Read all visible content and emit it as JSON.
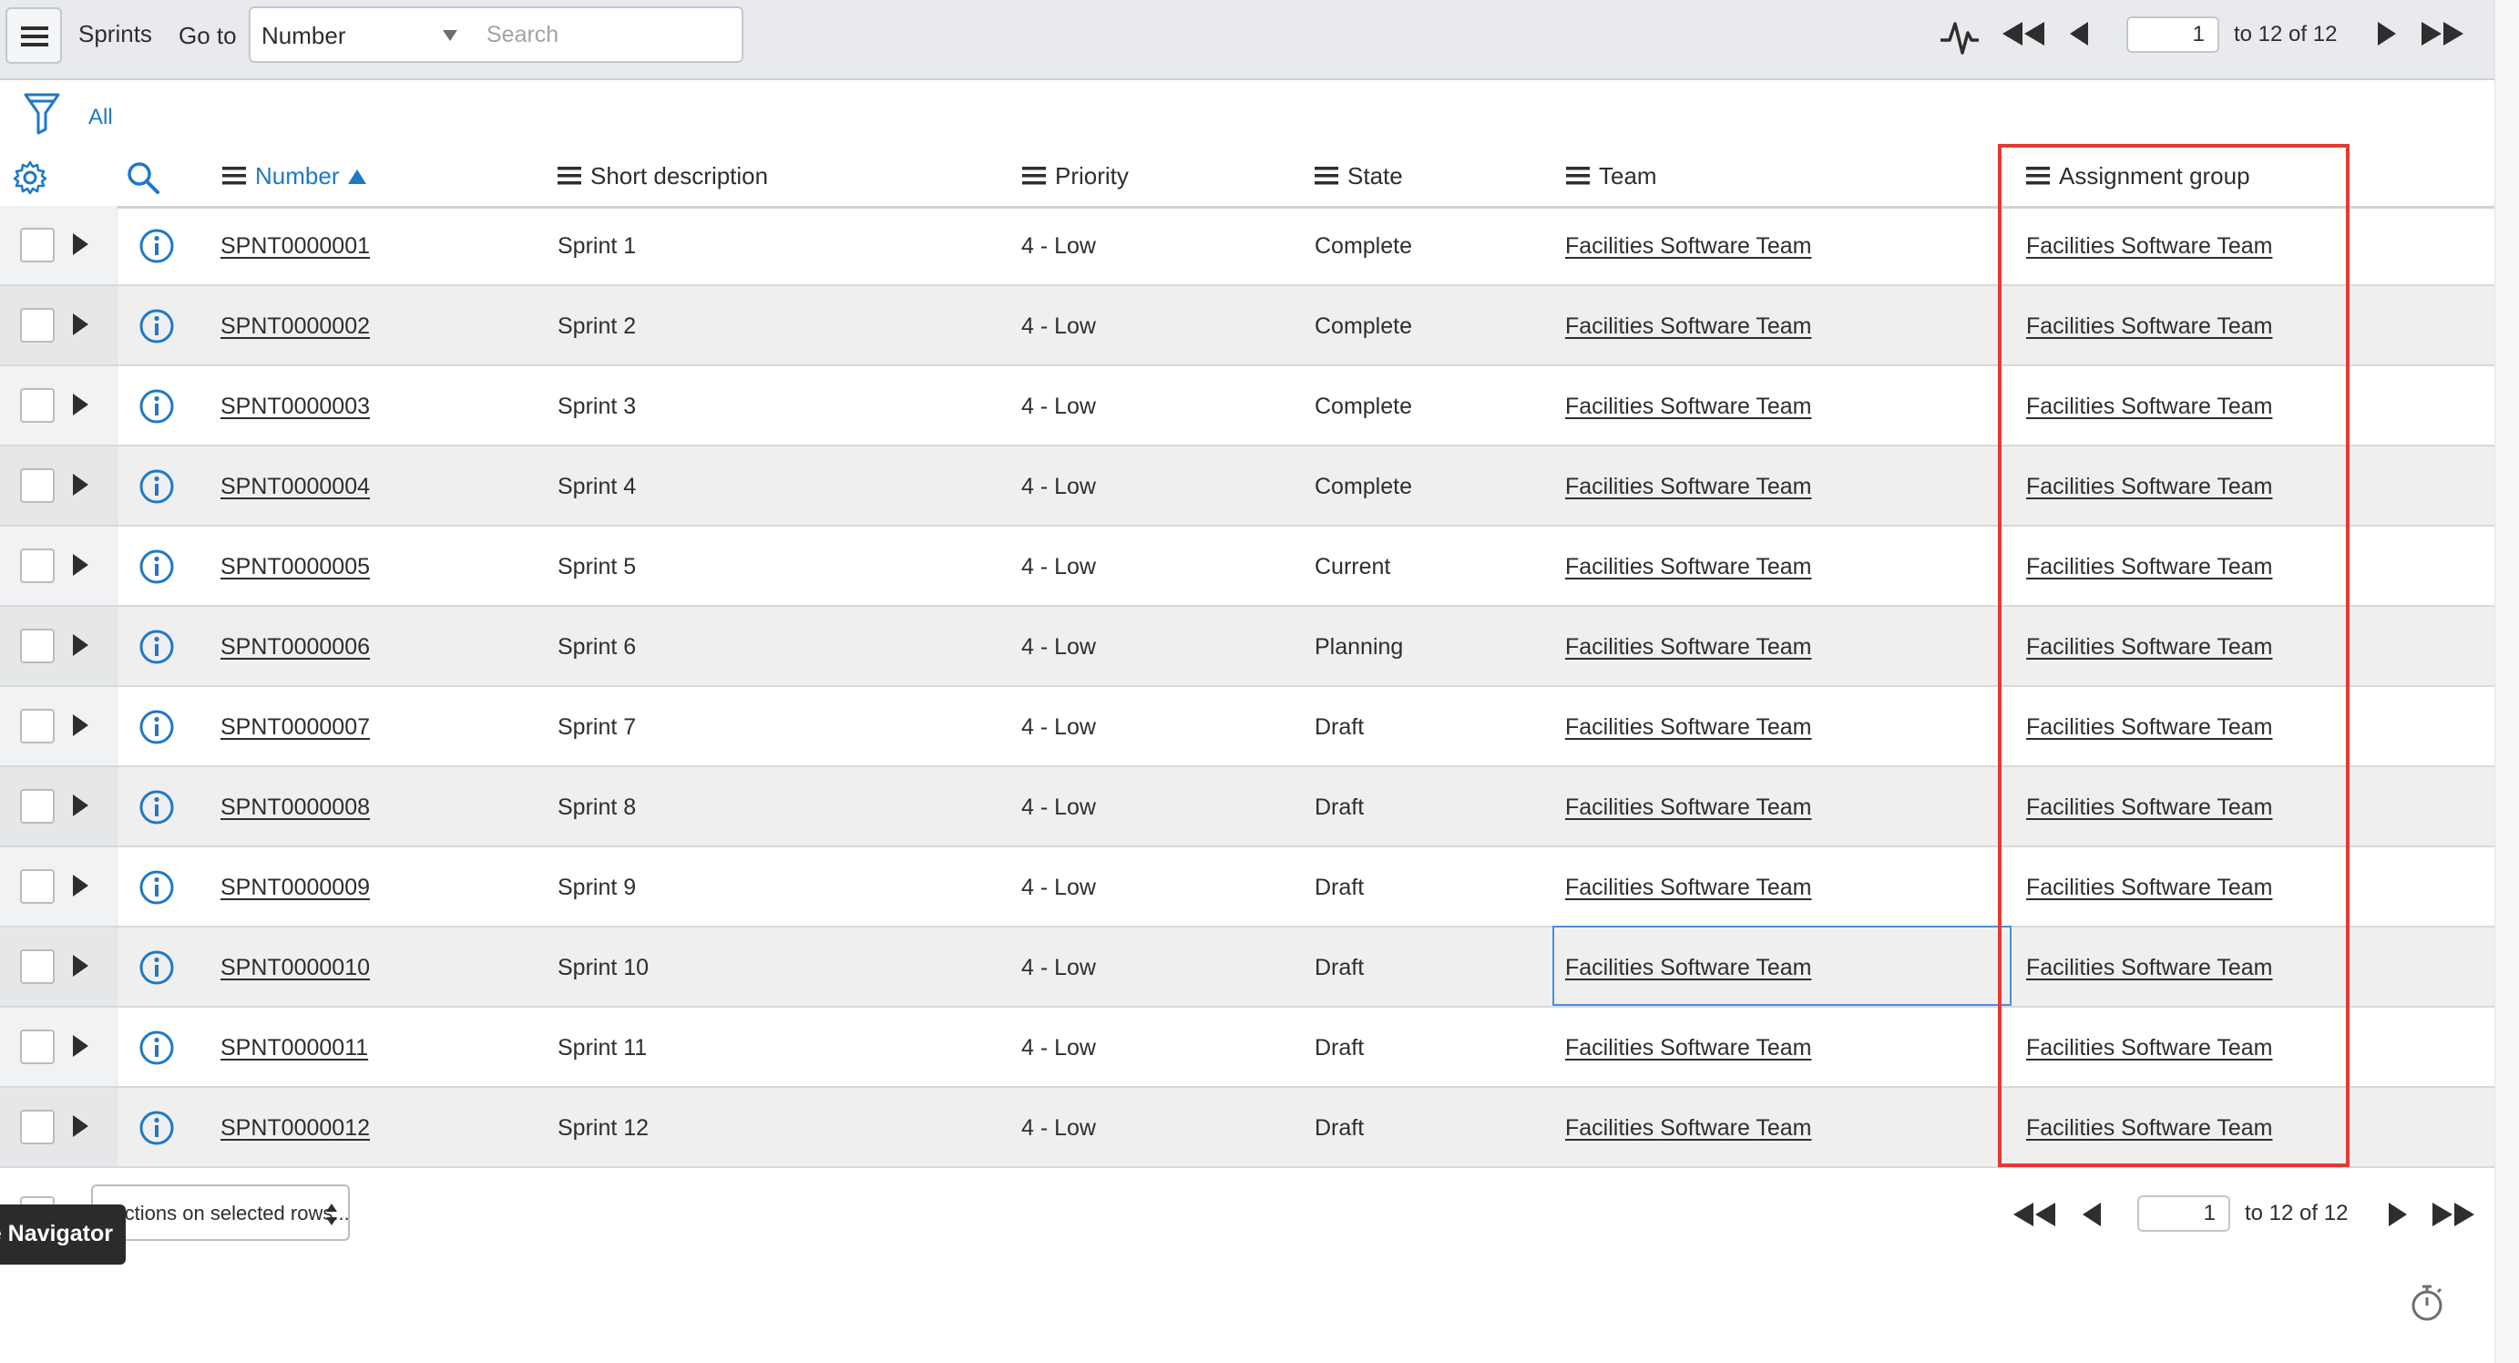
{
  "header": {
    "title": "Sprints",
    "goto_label": "Go to",
    "field_select": "Number",
    "search_placeholder": "Search",
    "page_value": "1",
    "page_range": "to 12 of 12"
  },
  "filter": {
    "label": "All"
  },
  "columns": {
    "number": "Number",
    "short_description": "Short description",
    "priority": "Priority",
    "state": "State",
    "team": "Team",
    "assignment_group": "Assignment group"
  },
  "rows": [
    {
      "number": "SPNT0000001",
      "short_description": "Sprint 1",
      "priority": "4 - Low",
      "state": "Complete",
      "team": "Facilities Software Team",
      "assignment_group": "Facilities Software Team"
    },
    {
      "number": "SPNT0000002",
      "short_description": "Sprint 2",
      "priority": "4 - Low",
      "state": "Complete",
      "team": "Facilities Software Team",
      "assignment_group": "Facilities Software Team"
    },
    {
      "number": "SPNT0000003",
      "short_description": "Sprint 3",
      "priority": "4 - Low",
      "state": "Complete",
      "team": "Facilities Software Team",
      "assignment_group": "Facilities Software Team"
    },
    {
      "number": "SPNT0000004",
      "short_description": "Sprint 4",
      "priority": "4 - Low",
      "state": "Complete",
      "team": "Facilities Software Team",
      "assignment_group": "Facilities Software Team"
    },
    {
      "number": "SPNT0000005",
      "short_description": "Sprint 5",
      "priority": "4 - Low",
      "state": "Current",
      "team": "Facilities Software Team",
      "assignment_group": "Facilities Software Team"
    },
    {
      "number": "SPNT0000006",
      "short_description": "Sprint 6",
      "priority": "4 - Low",
      "state": "Planning",
      "team": "Facilities Software Team",
      "assignment_group": "Facilities Software Team"
    },
    {
      "number": "SPNT0000007",
      "short_description": "Sprint 7",
      "priority": "4 - Low",
      "state": "Draft",
      "team": "Facilities Software Team",
      "assignment_group": "Facilities Software Team"
    },
    {
      "number": "SPNT0000008",
      "short_description": "Sprint 8",
      "priority": "4 - Low",
      "state": "Draft",
      "team": "Facilities Software Team",
      "assignment_group": "Facilities Software Team"
    },
    {
      "number": "SPNT0000009",
      "short_description": "Sprint 9",
      "priority": "4 - Low",
      "state": "Draft",
      "team": "Facilities Software Team",
      "assignment_group": "Facilities Software Team"
    },
    {
      "number": "SPNT0000010",
      "short_description": "Sprint 10",
      "priority": "4 - Low",
      "state": "Draft",
      "team": "Facilities Software Team",
      "assignment_group": "Facilities Software Team"
    },
    {
      "number": "SPNT0000011",
      "short_description": "Sprint 11",
      "priority": "4 - Low",
      "state": "Draft",
      "team": "Facilities Software Team",
      "assignment_group": "Facilities Software Team"
    },
    {
      "number": "SPNT0000012",
      "short_description": "Sprint 12",
      "priority": "4 - Low",
      "state": "Draft",
      "team": "Facilities Software Team",
      "assignment_group": "Facilities Software Team"
    }
  ],
  "footer": {
    "actions_select": "Actions on selected rows...",
    "page_value": "1",
    "page_range": "to 12 of 12",
    "navigator_tooltip": "e Navigator"
  },
  "colors": {
    "link_blue": "#1f78c8",
    "highlight_red": "#e53935",
    "focus_blue": "#4a90d9"
  }
}
